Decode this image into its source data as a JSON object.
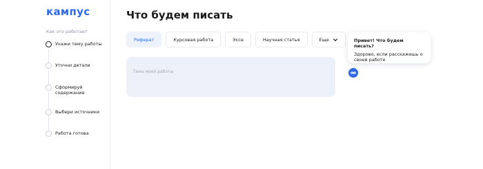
{
  "brand": {
    "logo_text": "кампус",
    "accent": "#2f6be8"
  },
  "sidebar": {
    "how_label": "Как это работает",
    "steps": [
      {
        "label": "Укажи тему работы",
        "active": true
      },
      {
        "label": "Уточни детали",
        "active": false
      },
      {
        "label": "Сформируй содержание",
        "active": false
      },
      {
        "label": "Выбери источники",
        "active": false
      },
      {
        "label": "Работа готова",
        "active": false
      }
    ]
  },
  "main": {
    "title": "Что будем писать",
    "chips": [
      {
        "label": "Реферат",
        "selected": true
      },
      {
        "label": "Курсовая работа",
        "selected": false
      },
      {
        "label": "Эссе",
        "selected": false
      },
      {
        "label": "Научная статья",
        "selected": false
      },
      {
        "label": "Еще",
        "selected": false,
        "icon": "chevron-down-icon"
      }
    ],
    "topic_input": {
      "placeholder": "Тема моей работы",
      "value": ""
    }
  },
  "assistant": {
    "heading": "Привет! Что будем писать?",
    "body": "Здорово, если расскажешь о своей работе",
    "icon": "assistant-bot-icon"
  }
}
